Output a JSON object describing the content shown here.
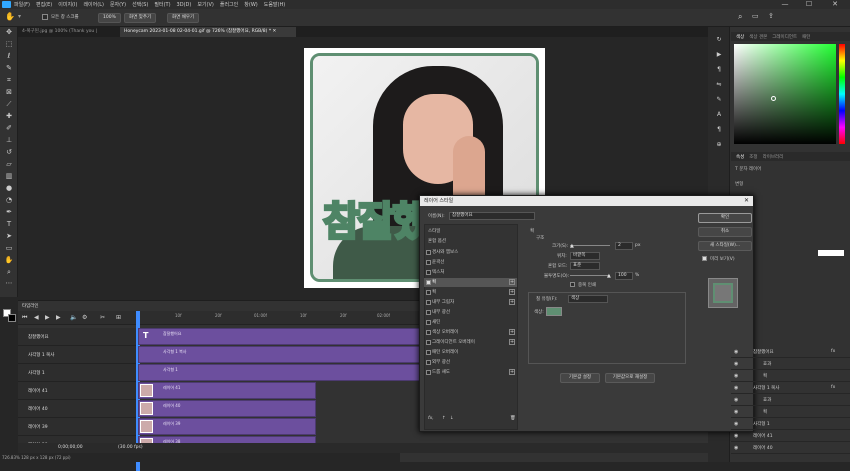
{
  "menubar": {
    "items": [
      "파일(F)",
      "편집(E)",
      "이미지(I)",
      "레이어(L)",
      "문자(Y)",
      "선택(S)",
      "필터(T)",
      "3D(D)",
      "보기(V)",
      "플러그인",
      "창(W)",
      "도움말(H)"
    ]
  },
  "window": {
    "minimize": "—",
    "maximize": "☐",
    "close": "✕"
  },
  "options": {
    "auto_select": "모든 창 스크롤",
    "zoom": "100%",
    "fit_screen": "화면 맞추기",
    "fill_screen": "화면 채우기"
  },
  "tabs": [
    {
      "label": "4-복구된.jpg @ 100% (Thank you | RGB/8#) * ✕"
    },
    {
      "label": "Honeycam 2023-01-08 02-04-01.gif @ 726% (참잘했어요, RGB/8) * ✕"
    }
  ],
  "canvas": {
    "sticker_text": "참잘했어요"
  },
  "timeline": {
    "title": "타임라인",
    "ruler": [
      "10f",
      "20f",
      "01:00f",
      "10f",
      "20f",
      "02:00f"
    ],
    "current_time": "0;00;00;00",
    "fps": "(30.00 fps)",
    "status": "726.83%    128 px x 128 px (72 ppi)",
    "rows": [
      {
        "label": "참잘했어요",
        "clip": "참잘했어요"
      },
      {
        "label": "사각형 1 복사",
        "clip": "사각형 1 복사"
      },
      {
        "label": "사각형 1",
        "clip": "사각형 1"
      },
      {
        "label": "레이어 41",
        "clip": "레이어 41"
      },
      {
        "label": "레이어 40",
        "clip": "레이어 40"
      },
      {
        "label": "레이어 39",
        "clip": "레이어 39"
      },
      {
        "label": "레이어 38",
        "clip": "레이어 38"
      }
    ]
  },
  "dialog": {
    "title": "레이어 스타일",
    "name_label": "이름(N):",
    "name_value": "참잘했어요",
    "styles_header": "스타일",
    "blend_header": "혼합 옵션",
    "effects": [
      {
        "label": "경사와 엠보스",
        "checked": false,
        "plus": false,
        "sel": false
      },
      {
        "label": "윤곽선",
        "checked": false,
        "plus": false,
        "sel": false
      },
      {
        "label": "텍스처",
        "checked": false,
        "plus": false,
        "sel": false
      },
      {
        "label": "획",
        "checked": true,
        "plus": true,
        "sel": true
      },
      {
        "label": "획",
        "checked": false,
        "plus": true,
        "sel": false
      },
      {
        "label": "내부 그림자",
        "checked": false,
        "plus": true,
        "sel": false
      },
      {
        "label": "내부 광선",
        "checked": false,
        "plus": false,
        "sel": false
      },
      {
        "label": "새틴",
        "checked": false,
        "plus": false,
        "sel": false
      },
      {
        "label": "색상 오버레이",
        "checked": false,
        "plus": true,
        "sel": false
      },
      {
        "label": "그레이디언트 오버레이",
        "checked": false,
        "plus": true,
        "sel": false
      },
      {
        "label": "패턴 오버레이",
        "checked": false,
        "plus": false,
        "sel": false
      },
      {
        "label": "외부 광선",
        "checked": false,
        "plus": false,
        "sel": false
      },
      {
        "label": "드롭 섀도",
        "checked": false,
        "plus": true,
        "sel": false
      }
    ],
    "section_title": "획",
    "structure": "구조",
    "size_label": "크기(S):",
    "size_value": "2",
    "size_unit": "px",
    "position_label": "위치:",
    "position_value": "바깥쪽",
    "blend_label": "혼합 모드:",
    "blend_value": "표준",
    "opacity_label": "불투명도(O):",
    "opacity_value": "100",
    "opacity_unit": "%",
    "overprint": "중복 인쇄",
    "fill_type_label": "칠 유형(F):",
    "fill_type_value": "색상",
    "color_label": "색상:",
    "stroke_color": "#5f8f72",
    "set_default": "기본값 설정",
    "reset_default": "기본값으로 재설정",
    "ok": "확인",
    "cancel": "취소",
    "new_style": "새 스타일(W)...",
    "preview": "미리 보기(V)",
    "fx": "fx,"
  },
  "right": {
    "color_tabs": [
      "색상",
      "색상 견본",
      "그레이디언트",
      "패턴"
    ],
    "props_tabs": [
      "속성",
      "조정",
      "라이브러리"
    ],
    "type_layer": "문자 레이어",
    "transform": "변형",
    "character": "문자",
    "layers_rows": [
      {
        "name": "참잘했어요",
        "fx": true
      },
      {
        "name": "효과",
        "fx": false
      },
      {
        "name": "획",
        "fx": false
      },
      {
        "name": "사각형 1 복사",
        "fx": true
      },
      {
        "name": "효과",
        "fx": false
      },
      {
        "name": "획",
        "fx": false
      },
      {
        "name": "사각형 1",
        "fx": false
      },
      {
        "name": "레이어 41",
        "fx": false
      },
      {
        "name": "레이어 40",
        "fx": false
      }
    ]
  }
}
